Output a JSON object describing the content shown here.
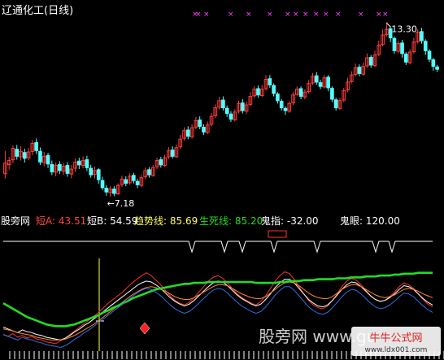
{
  "title": "辽通化工(日线)",
  "wm_mid": "股旁网 www.gu",
  "wm_right": "牛牛公式网",
  "wm_url": "www.ldx001.com",
  "colors": {
    "bg": "#000000",
    "up": "#ff3c3c",
    "down": "#54ffff",
    "white": "#ffffff",
    "mark": "#ff44ff",
    "green": "#22dd22",
    "yellow": "#ffff55",
    "red": "#ff3030",
    "orange": "#ff8833",
    "blue": "#3a78ff",
    "signal_red": "#ff2020"
  },
  "indicator_labels": [
    {
      "id": "name",
      "text": "股旁网",
      "color": "#ffffff"
    },
    {
      "id": "short_a",
      "text": "短A: 43.51",
      "color": "#ff4444"
    },
    {
      "id": "short_b",
      "text": "短B: 54.59",
      "color": "#ffffff"
    },
    {
      "id": "trend",
      "text": "趋势线: 85.69",
      "color": "#ffff55"
    },
    {
      "id": "lifedeath",
      "text": "生死线: 85.20",
      "color": "#22dd22"
    },
    {
      "id": "ghost_finger",
      "text": "鬼指: -32.00",
      "color": "#ffffff"
    },
    {
      "id": "ghost_eye",
      "text": "鬼眼: 120.00",
      "color": "#ffffff"
    }
  ],
  "chart_data": [
    {
      "type": "candlestick",
      "title": "辽通化工(日线)",
      "annotations": [
        {
          "text": "←7.18",
          "value": 7.18
        },
        {
          "text": "13.30",
          "value": 13.3
        }
      ],
      "candles": [
        [
          7.99,
          8.36,
          8.79,
          7.82
        ],
        [
          8.31,
          8.45,
          8.58,
          8.14
        ],
        [
          8.48,
          8.88,
          8.98,
          8.36
        ],
        [
          8.85,
          8.6,
          9.0,
          8.48
        ],
        [
          8.58,
          8.77,
          8.95,
          8.45
        ],
        [
          8.73,
          8.53,
          8.87,
          8.38
        ],
        [
          8.55,
          8.75,
          8.89,
          8.46
        ],
        [
          8.77,
          9.05,
          9.17,
          8.64
        ],
        [
          9.08,
          8.8,
          9.22,
          8.68
        ],
        [
          8.77,
          8.4,
          8.91,
          8.3
        ],
        [
          8.38,
          8.6,
          8.75,
          8.25
        ],
        [
          8.63,
          8.33,
          8.72,
          8.19
        ],
        [
          8.31,
          8.05,
          8.45,
          7.94
        ],
        [
          8.04,
          8.28,
          8.38,
          7.9
        ],
        [
          8.31,
          8.1,
          8.43,
          7.98
        ],
        [
          8.08,
          8.25,
          8.36,
          7.95
        ],
        [
          8.28,
          8.0,
          8.4,
          7.88
        ],
        [
          7.98,
          8.15,
          8.29,
          7.83
        ],
        [
          8.18,
          8.4,
          8.53,
          8.05
        ],
        [
          8.43,
          8.3,
          8.55,
          8.15
        ],
        [
          8.28,
          8.45,
          8.6,
          8.18
        ],
        [
          8.48,
          8.2,
          8.62,
          8.08
        ],
        [
          8.18,
          7.95,
          8.3,
          7.85
        ],
        [
          7.97,
          8.1,
          8.25,
          7.82
        ],
        [
          8.13,
          7.78,
          8.18,
          7.64
        ],
        [
          7.75,
          7.5,
          7.88,
          7.42
        ],
        [
          7.48,
          7.35,
          7.58,
          7.22
        ],
        [
          7.33,
          7.45,
          7.55,
          7.18
        ],
        [
          7.45,
          7.3,
          7.55,
          7.2
        ],
        [
          7.28,
          7.58,
          7.65,
          7.25
        ],
        [
          7.61,
          7.8,
          7.92,
          7.52
        ],
        [
          7.78,
          7.65,
          7.9,
          7.55
        ],
        [
          7.67,
          7.9,
          8.0,
          7.6
        ],
        [
          7.93,
          7.75,
          8.02,
          7.65
        ],
        [
          7.72,
          7.6,
          7.8,
          7.48
        ],
        [
          7.58,
          7.85,
          7.95,
          7.52
        ],
        [
          7.88,
          8.1,
          8.2,
          7.8
        ],
        [
          8.13,
          7.95,
          8.22,
          7.85
        ],
        [
          7.93,
          8.2,
          8.3,
          7.88
        ],
        [
          8.23,
          8.45,
          8.55,
          8.15
        ],
        [
          8.48,
          8.3,
          8.58,
          8.2
        ],
        [
          8.28,
          8.55,
          8.65,
          8.22
        ],
        [
          8.58,
          8.8,
          8.92,
          8.5
        ],
        [
          8.82,
          8.6,
          8.95,
          8.52
        ],
        [
          8.58,
          8.9,
          9.02,
          8.55
        ],
        [
          8.93,
          9.2,
          9.35,
          8.85
        ],
        [
          9.23,
          9.5,
          9.62,
          9.15
        ],
        [
          9.52,
          9.3,
          9.65,
          9.2
        ],
        [
          9.28,
          9.6,
          9.72,
          9.22
        ],
        [
          9.62,
          9.85,
          9.98,
          9.55
        ],
        [
          9.87,
          9.65,
          10.0,
          9.55
        ],
        [
          9.62,
          9.45,
          9.72,
          9.35
        ],
        [
          9.43,
          9.7,
          9.82,
          9.38
        ],
        [
          9.72,
          10.0,
          10.12,
          9.65
        ],
        [
          10.02,
          10.3,
          10.42,
          9.95
        ],
        [
          10.32,
          10.55,
          10.68,
          10.25
        ],
        [
          10.57,
          10.3,
          10.7,
          10.2
        ],
        [
          10.28,
          10.1,
          10.38,
          9.98
        ],
        [
          10.08,
          9.9,
          10.18,
          9.8
        ],
        [
          9.88,
          10.15,
          10.25,
          9.82
        ],
        [
          10.18,
          10.45,
          10.55,
          10.1
        ],
        [
          10.47,
          10.2,
          10.6,
          10.1
        ],
        [
          10.18,
          10.4,
          10.52,
          10.08
        ],
        [
          10.42,
          10.7,
          10.85,
          10.35
        ],
        [
          10.72,
          10.95,
          11.05,
          10.65
        ],
        [
          10.97,
          10.75,
          11.08,
          10.65
        ],
        [
          10.73,
          10.95,
          11.1,
          10.68
        ],
        [
          10.97,
          11.3,
          11.45,
          10.9
        ],
        [
          11.32,
          11.1,
          11.45,
          11.0
        ],
        [
          11.08,
          10.8,
          11.15,
          10.7
        ],
        [
          10.78,
          10.55,
          10.85,
          10.45
        ],
        [
          10.53,
          10.3,
          10.6,
          10.2
        ],
        [
          10.28,
          10.2,
          10.35,
          10.05
        ],
        [
          10.18,
          10.45,
          10.52,
          10.12
        ],
        [
          10.47,
          10.75,
          10.85,
          10.4
        ],
        [
          10.77,
          10.95,
          11.05,
          10.7
        ],
        [
          10.97,
          10.7,
          11.05,
          10.6
        ],
        [
          10.68,
          10.85,
          10.95,
          10.6
        ],
        [
          10.87,
          11.15,
          11.28,
          10.8
        ],
        [
          11.17,
          11.4,
          11.52,
          11.1
        ],
        [
          11.42,
          11.2,
          11.55,
          11.1
        ],
        [
          11.18,
          11.05,
          11.28,
          10.95
        ],
        [
          11.03,
          11.35,
          11.45,
          10.98
        ],
        [
          11.37,
          11.0,
          11.45,
          10.88
        ],
        [
          10.98,
          10.6,
          11.05,
          10.5
        ],
        [
          10.58,
          10.3,
          10.65,
          10.2
        ],
        [
          10.28,
          10.55,
          10.65,
          10.22
        ],
        [
          10.57,
          10.9,
          11.0,
          10.5
        ],
        [
          10.92,
          11.2,
          11.35,
          10.85
        ],
        [
          11.22,
          11.45,
          11.58,
          11.15
        ],
        [
          11.47,
          11.7,
          11.85,
          11.4
        ],
        [
          11.72,
          11.5,
          11.82,
          11.4
        ],
        [
          11.48,
          11.75,
          11.88,
          11.42
        ],
        [
          11.77,
          12.05,
          12.2,
          11.7
        ],
        [
          12.07,
          11.8,
          12.15,
          11.7
        ],
        [
          11.78,
          12.15,
          12.3,
          11.72
        ],
        [
          12.17,
          12.5,
          12.65,
          12.1
        ],
        [
          12.52,
          12.85,
          13.05,
          12.45
        ],
        [
          12.87,
          13.05,
          13.3,
          12.8
        ],
        [
          13.07,
          12.75,
          13.15,
          12.6
        ],
        [
          12.73,
          12.3,
          12.8,
          12.2
        ],
        [
          12.28,
          12.55,
          12.65,
          12.2
        ],
        [
          12.57,
          12.2,
          12.68,
          12.05
        ],
        [
          12.18,
          11.9,
          12.25,
          11.8
        ],
        [
          11.88,
          12.25,
          12.35,
          11.82
        ],
        [
          12.27,
          12.6,
          12.75,
          12.2
        ],
        [
          12.62,
          12.95,
          13.05,
          12.55
        ],
        [
          12.97,
          12.65,
          13.1,
          12.55
        ],
        [
          12.63,
          12.3,
          12.7,
          12.15
        ],
        [
          12.28,
          12.0,
          12.35,
          11.9
        ],
        [
          11.98,
          11.75,
          12.05,
          11.6
        ],
        [
          11.73,
          11.65,
          11.8,
          11.55
        ]
      ]
    },
    {
      "type": "line",
      "title": "股旁网",
      "series": [
        {
          "name": "短A",
          "values": [
            18,
            16,
            19,
            15,
            17,
            14,
            16,
            13,
            12,
            10,
            9,
            8,
            11,
            14,
            18,
            22,
            26,
            30,
            34,
            38,
            42,
            47,
            52,
            56,
            60,
            64,
            69,
            74,
            78,
            82,
            85,
            82,
            77,
            72,
            66,
            60,
            55,
            52,
            50,
            53,
            58,
            64,
            70,
            76,
            80,
            82,
            79,
            74,
            68,
            62,
            58,
            55,
            52,
            50,
            54,
            60,
            68,
            76,
            82,
            86,
            84,
            78,
            70,
            62,
            55,
            50,
            47,
            46,
            49,
            55,
            62,
            70,
            76,
            79,
            77,
            72,
            66,
            60,
            56,
            54,
            55,
            59,
            64,
            70,
            74,
            72,
            68,
            62,
            56,
            51,
            48
          ]
        },
        {
          "name": "短B",
          "values": [
            26,
            24,
            22,
            20,
            23,
            21,
            20,
            18,
            17,
            15,
            14,
            13,
            12,
            14,
            17,
            21,
            24,
            28,
            31,
            35,
            39,
            43,
            47,
            51,
            55,
            59,
            63,
            67,
            71,
            74,
            76,
            75,
            72,
            68,
            63,
            58,
            54,
            51,
            49,
            51,
            55,
            60,
            65,
            70,
            74,
            76,
            75,
            71,
            66,
            61,
            57,
            54,
            51,
            49,
            51,
            56,
            62,
            69,
            74,
            78,
            78,
            74,
            68,
            62,
            56,
            52,
            49,
            48,
            50,
            55,
            61,
            67,
            72,
            75,
            74,
            70,
            65,
            60,
            56,
            54,
            55,
            58,
            62,
            67,
            71,
            70,
            67,
            62,
            57,
            53,
            50
          ]
        },
        {
          "name": "趋势线",
          "values": [
            24,
            23,
            22,
            20,
            19,
            18,
            17,
            15,
            14,
            13,
            12,
            12,
            12,
            13,
            15,
            17,
            20,
            23,
            26,
            29,
            33,
            37,
            41,
            45,
            49,
            53,
            57,
            61,
            64,
            67,
            69,
            70,
            69,
            67,
            65,
            62,
            59,
            57,
            56,
            56,
            58,
            61,
            64,
            67,
            70,
            72,
            72,
            71,
            68,
            65,
            62,
            60,
            58,
            57,
            57,
            59,
            63,
            67,
            71,
            74,
            75,
            74,
            71,
            67,
            63,
            60,
            58,
            57,
            57,
            59,
            63,
            67,
            70,
            72,
            72,
            70,
            67,
            64,
            61,
            59,
            58,
            59,
            61,
            64,
            67,
            68,
            67,
            65,
            62,
            60,
            58
          ]
        },
        {
          "name": "生死线",
          "values": [
            52,
            49,
            46,
            43,
            40,
            37,
            35,
            33,
            31,
            29,
            28,
            27,
            27,
            27,
            28,
            29,
            31,
            33,
            35,
            37,
            39,
            42,
            44,
            47,
            49,
            52,
            54,
            57,
            59,
            61,
            63,
            65,
            67,
            68,
            69,
            70,
            71,
            72,
            73,
            73,
            74,
            74,
            74,
            75,
            75,
            75,
            75,
            75,
            75,
            75,
            75,
            75,
            75,
            74,
            74,
            74,
            74,
            74,
            75,
            75,
            76,
            76,
            76,
            77,
            77,
            77,
            78,
            78,
            78,
            78,
            79,
            79,
            79,
            80,
            80,
            80,
            81,
            81,
            81,
            82,
            82,
            82,
            83,
            83,
            84,
            84,
            84,
            85,
            85,
            85,
            85
          ]
        }
      ],
      "ghost_finger_signals": [
        26,
        30,
        34,
        38,
        42,
        46,
        50,
        54,
        58,
        62,
        66,
        70
      ],
      "trend_signal_ylim": [
        0,
        120
      ]
    }
  ]
}
